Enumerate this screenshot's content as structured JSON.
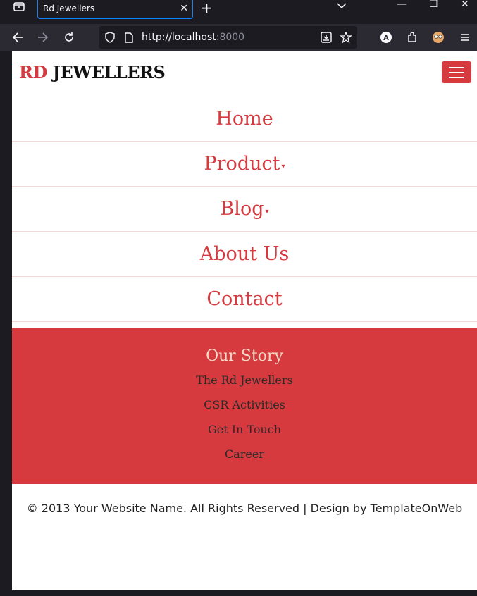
{
  "browser": {
    "tab_title": "Rd Jewellers",
    "tab_close": "✕",
    "new_tab": "+",
    "url_host": "http://localhost",
    "url_port": ":8000",
    "min_glyph": "—",
    "max_glyph": "☐",
    "close_glyph": "✕",
    "profile_letter": "A"
  },
  "site": {
    "logo_accent": "RD",
    "logo_main": " JEWELLERS",
    "accent_color": "#d63a3e"
  },
  "nav": {
    "home": "Home",
    "product": "Product",
    "blog": "Blog",
    "about": "About Us",
    "contact": "Contact",
    "caret": "▾"
  },
  "story": {
    "title": "Our Story",
    "links": [
      "The Rd Jewellers",
      "CSR Activities",
      "Get In Touch",
      "Career"
    ]
  },
  "footer": {
    "copyright": "© 2013 Your Website Name. All Rights Reserved | Design by TemplateOnWeb"
  }
}
